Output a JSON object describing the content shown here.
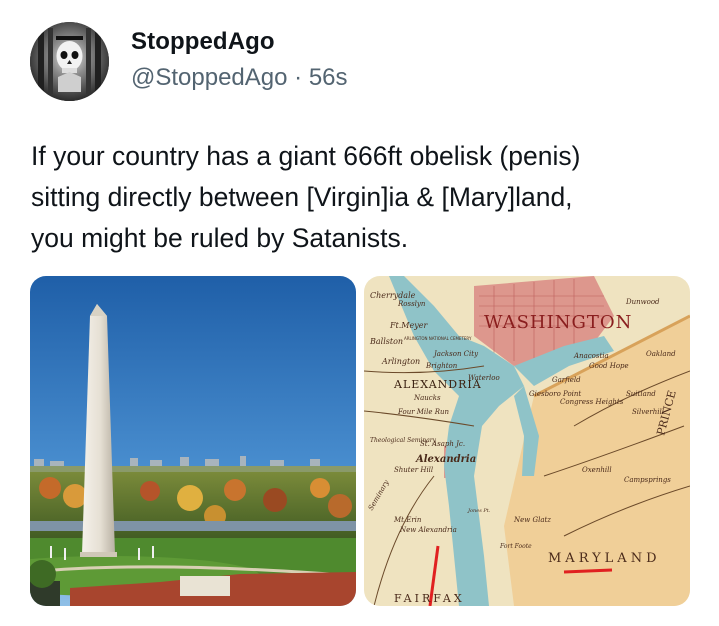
{
  "author": {
    "name": "StoppedAgo",
    "handle": "@StoppedAgo",
    "separator": "·",
    "time": "56s",
    "avatar_icon": "avatar-skull-icon"
  },
  "post": {
    "text": "If your country has a giant 666ft obelisk (penis)\nsitting directly between [Virgin]ia & [Mary]land,\nyou might be ruled by Satanists."
  },
  "media": {
    "left_image": "washington-monument-photo",
    "right_image": "historic-map-of-washington-region",
    "map_labels": {
      "cherrydale": "Cherrydale",
      "rosslyn": "Rosslyn",
      "ft_meyer": "Ft.Meyer",
      "washington": "WASHINGTON",
      "ballston": "Ballston",
      "arlington_cemetery": "ARLINGTON NATIONAL CEMETERY",
      "jackson_city": "Jackson City",
      "arlington": "Arlington",
      "brighton": "Brighton",
      "alexandria_upper": "ALEXANDRIA",
      "waterloo": "Waterloo",
      "naucks": "Naucks",
      "four_mile_run": "Four Mile Run",
      "garfield": "Garfield",
      "giesboro_point": "Giesboro Point",
      "congress_heights": "Congress Heights",
      "good_hope": "Good Hope",
      "anacostia": "Anacostia",
      "suitland": "Suitland",
      "silverhill": "Silverhill",
      "oakland": "Oakland",
      "theological_seminary": "Theological Seminary",
      "st_asaph": "St. Asaph Jc.",
      "alexandria": "Alexandria",
      "shuter_hill": "Shuter Hill",
      "seminary": "Seminary",
      "mt_erin": "Mt.Erin",
      "new_alexandria": "New Alexandria",
      "jones_pt": "Jones Pt.",
      "new_glatz": "New Glatz",
      "oxenhill": "Oxenhill",
      "campsprings": "Campsprings",
      "fort_foote": "Fort Foote",
      "maryland": "MARYLAND",
      "fairfax": "FAIRFAX",
      "dunwood": "Dunwood",
      "prince": "PRINCE"
    }
  }
}
